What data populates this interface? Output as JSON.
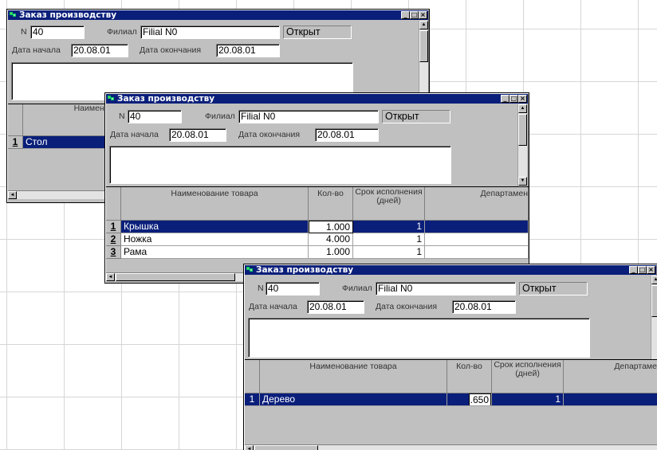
{
  "windows": [
    {
      "title": "Заказ производству",
      "n_label": "N",
      "n_value": "40",
      "branch_label": "Филиал",
      "branch_value": "Filial N0",
      "status": "Открыт",
      "start_label": "Дата начала",
      "start_value": "20.08.01",
      "end_label": "Дата окончания",
      "end_value": "20.08.01",
      "col_name": "Наименс",
      "rows": [
        {
          "idx": "1",
          "name": "Стол"
        }
      ]
    },
    {
      "title": "Заказ производству",
      "n_label": "N",
      "n_value": "40",
      "branch_label": "Филиал",
      "branch_value": "Filial N0",
      "status": "Открыт",
      "start_label": "Дата начала",
      "start_value": "20.08.01",
      "end_label": "Дата окончания",
      "end_value": "20.08.01",
      "col_name": "Наименование товара",
      "col_qty": "Кол-во",
      "col_term": "Срок исполнения (дней)",
      "col_dept": "Департамен",
      "rows": [
        {
          "idx": "1",
          "name": "Крышка",
          "qty": "1.000",
          "term": "1"
        },
        {
          "idx": "2",
          "name": "Ножка",
          "qty": "4.000",
          "term": "1"
        },
        {
          "idx": "3",
          "name": "Рама",
          "qty": "1.000",
          "term": "1"
        }
      ]
    },
    {
      "title": "Заказ производству",
      "n_label": "N",
      "n_value": "40",
      "branch_label": "Филиал",
      "branch_value": "Filial N0",
      "status": "Открыт",
      "start_label": "Дата начала",
      "start_value": "20.08.01",
      "end_label": "Дата окончания",
      "end_value": "20.08.01",
      "col_name": "Наименование товара",
      "col_qty": "Кол-во",
      "col_term": "Срок исполнения (дней)",
      "col_dept": "Департаме",
      "rows": [
        {
          "idx": "1",
          "name": "Дерево",
          "qty": ".650",
          "term": "1"
        }
      ]
    }
  ],
  "window_buttons": {
    "minimize": "_",
    "maximize": "□",
    "close": "×"
  },
  "icons": {
    "scroll_up": "▲",
    "scroll_down": "▼",
    "scroll_left": "◄"
  }
}
